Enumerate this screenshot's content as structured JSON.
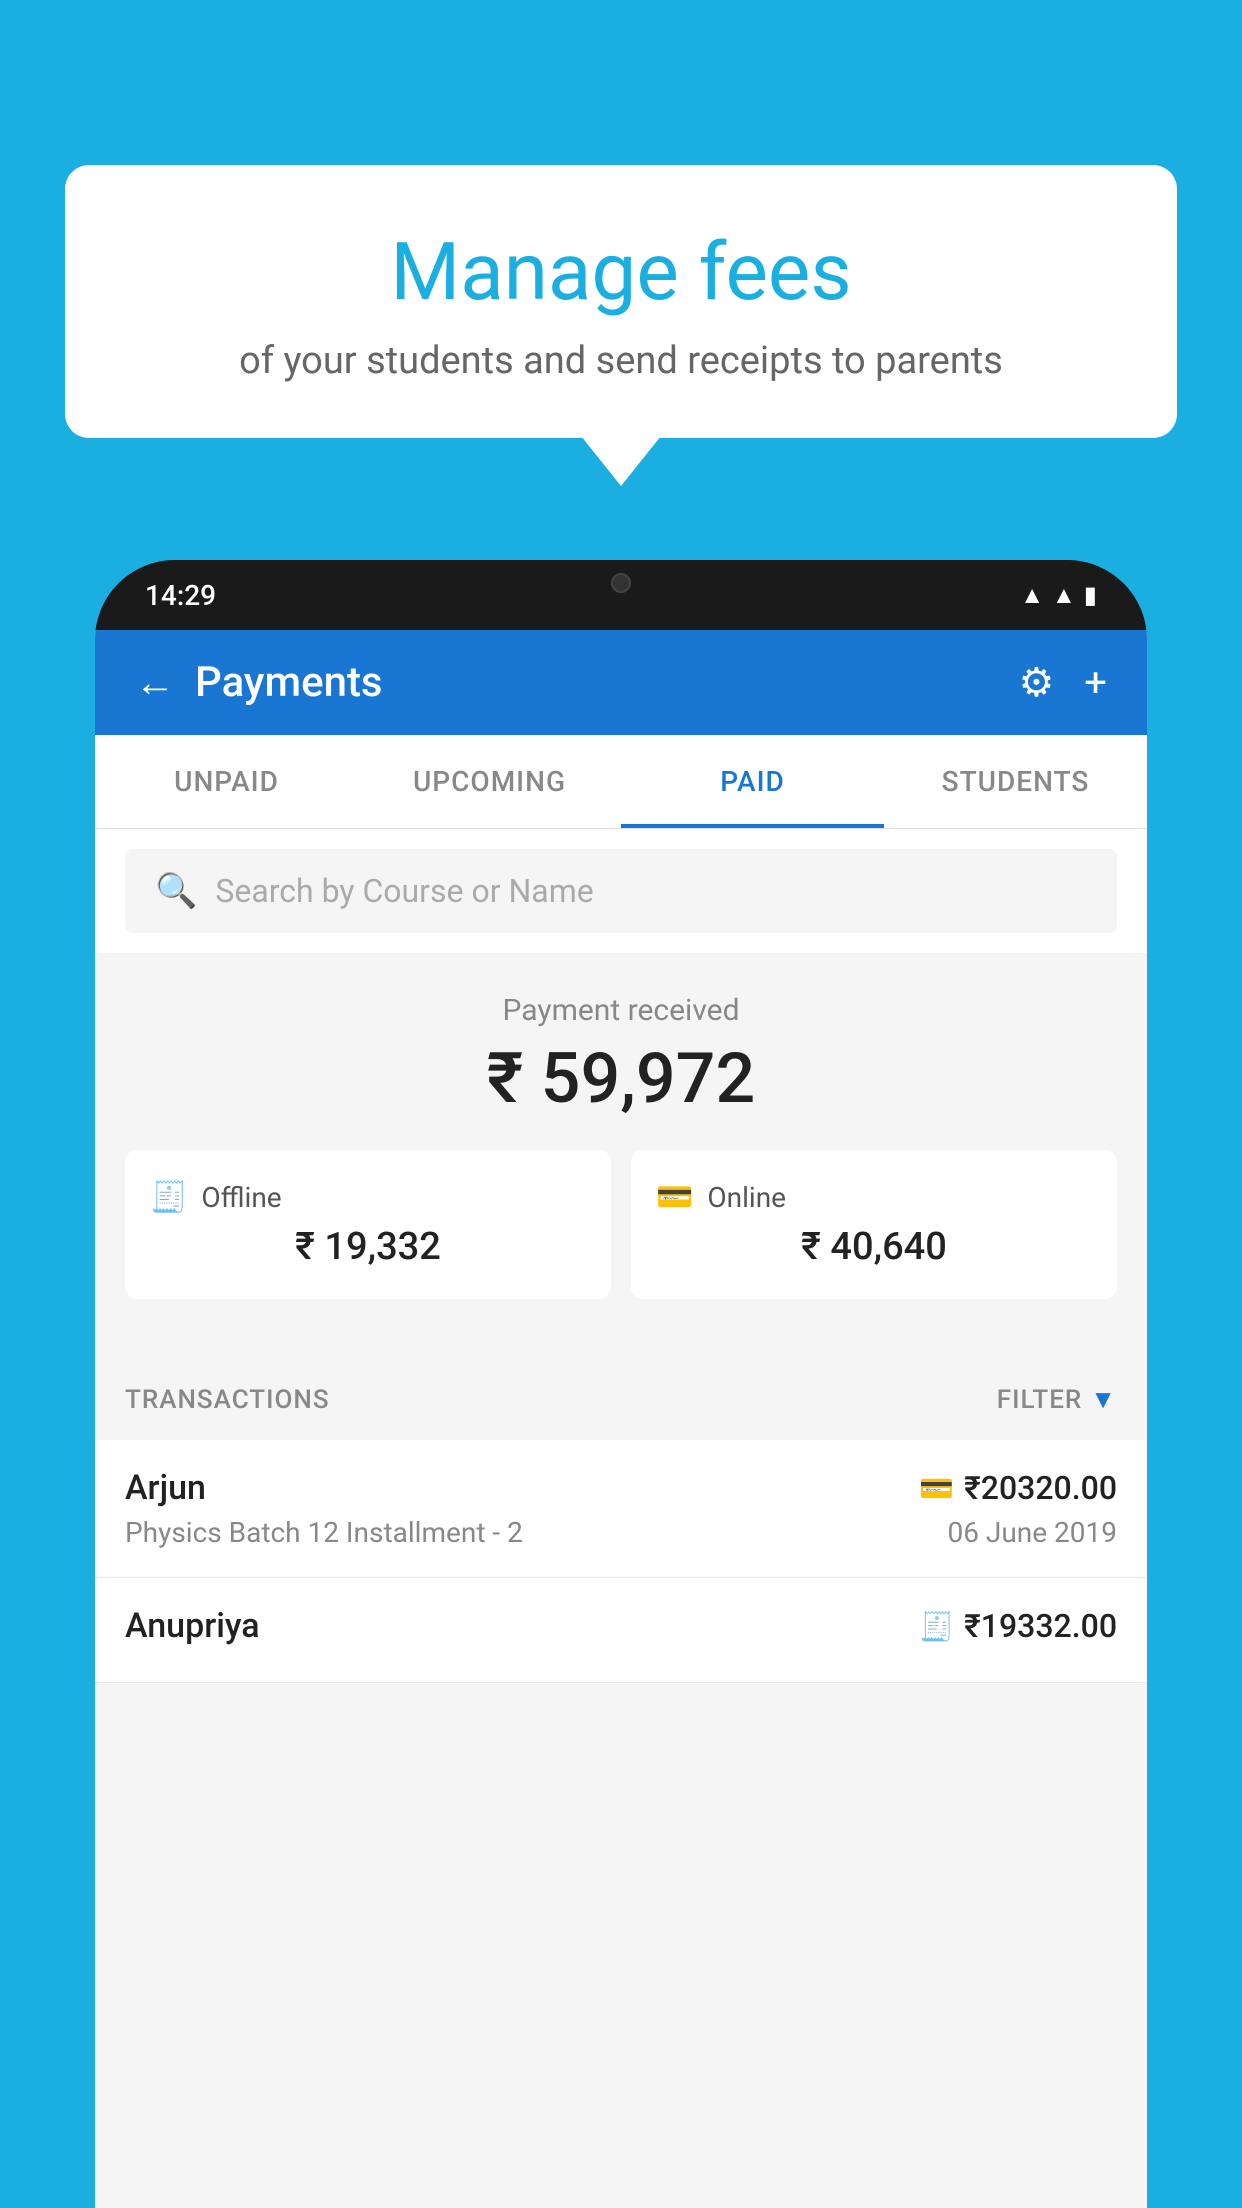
{
  "background_color": "#1AAFE0",
  "speech_bubble": {
    "title": "Manage fees",
    "subtitle": "of your students and send receipts to parents"
  },
  "phone": {
    "status_bar": {
      "time": "14:29"
    },
    "header": {
      "title": "Payments",
      "back_label": "←",
      "settings_icon": "⚙",
      "add_icon": "+"
    },
    "tabs": [
      {
        "label": "UNPAID",
        "active": false
      },
      {
        "label": "UPCOMING",
        "active": false
      },
      {
        "label": "PAID",
        "active": true
      },
      {
        "label": "STUDENTS",
        "active": false
      }
    ],
    "search": {
      "placeholder": "Search by Course or Name"
    },
    "payment_summary": {
      "received_label": "Payment received",
      "amount": "₹ 59,972",
      "offline_label": "Offline",
      "offline_amount": "₹ 19,332",
      "online_label": "Online",
      "online_amount": "₹ 40,640"
    },
    "transactions": {
      "label": "TRANSACTIONS",
      "filter_label": "FILTER",
      "items": [
        {
          "name": "Arjun",
          "course": "Physics Batch 12 Installment - 2",
          "amount": "₹20320.00",
          "date": "06 June 2019",
          "payment_type": "online"
        },
        {
          "name": "Anupriya",
          "amount": "₹19332.00",
          "payment_type": "offline"
        }
      ]
    }
  }
}
